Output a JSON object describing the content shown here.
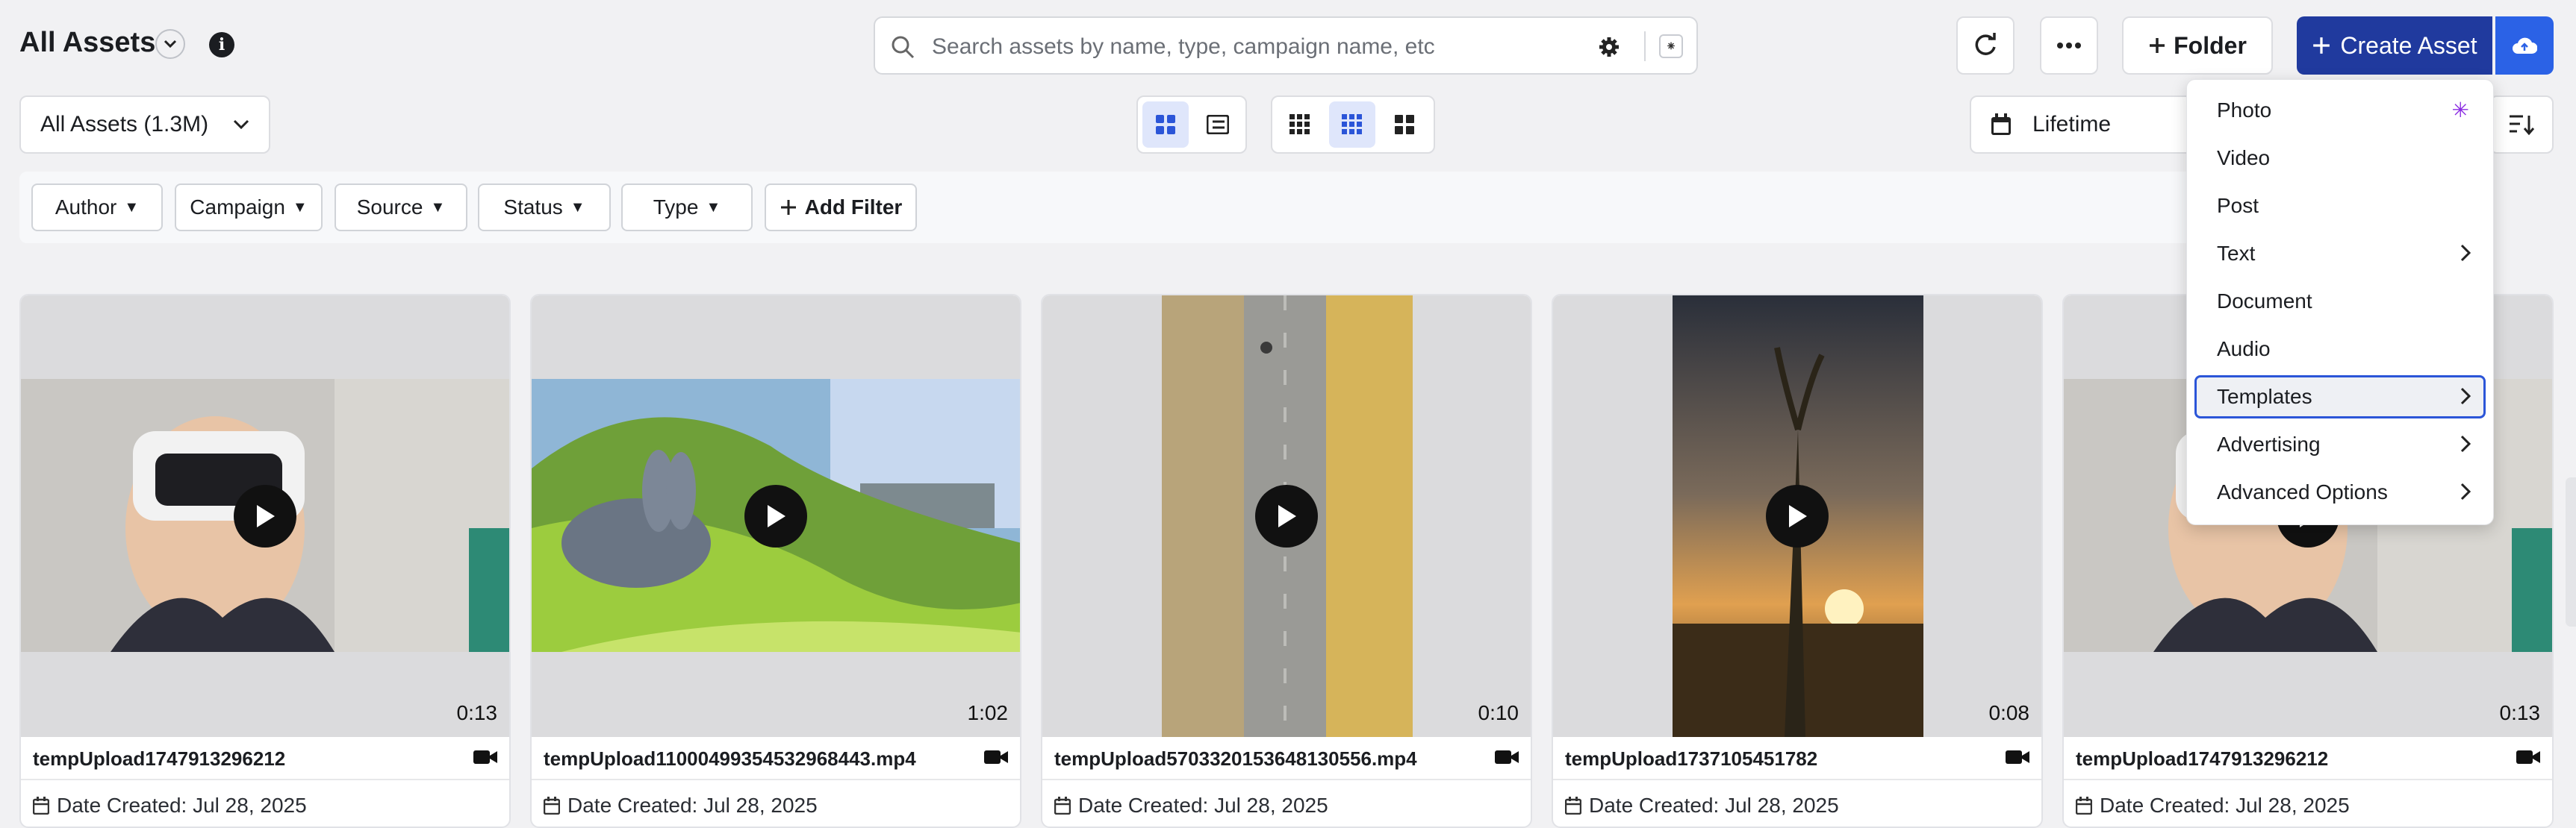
{
  "header": {
    "title": "All Assets",
    "info_symbol": "i",
    "search_placeholder": "Search assets by name, type, campaign name, etc",
    "search_ai_symbol": "⁕",
    "folder_label": "Folder",
    "create_label": "Create Asset"
  },
  "toolbar": {
    "assets_select": "All Assets (1.3M)",
    "date_range": "Lifetime"
  },
  "filters": [
    "Author",
    "Campaign",
    "Source",
    "Status",
    "Type"
  ],
  "add_filter_label": "Add Filter",
  "assets": [
    {
      "name": "tempUpload1747913296212",
      "duration": "0:13",
      "date": "Date Created: Jul 28, 2025"
    },
    {
      "name": "tempUpload11000499354532968443.mp4",
      "duration": "1:02",
      "date": "Date Created: Jul 28, 2025"
    },
    {
      "name": "tempUpload5703320153648130556.mp4",
      "duration": "0:10",
      "date": "Date Created: Jul 28, 2025"
    },
    {
      "name": "tempUpload1737105451782",
      "duration": "0:08",
      "date": "Date Created: Jul 28, 2025"
    },
    {
      "name": "tempUpload1747913296212",
      "duration": "0:13",
      "date": "Date Created: Jul 28, 2025"
    }
  ],
  "create_menu": {
    "items": [
      {
        "label": "Photo",
        "sparkle": "✳"
      },
      {
        "label": "Video"
      },
      {
        "label": "Post"
      },
      {
        "label": "Text"
      },
      {
        "label": "Document"
      },
      {
        "label": "Audio"
      },
      {
        "label": "Templates"
      },
      {
        "label": "Advertising"
      },
      {
        "label": "Advanced Options"
      }
    ],
    "highlighted": "Templates"
  },
  "colors": {
    "primary": "#203a9e",
    "primary_light": "#2b62e6",
    "highlight_border": "#2b55d8",
    "sparkle": "#8a2be2"
  }
}
